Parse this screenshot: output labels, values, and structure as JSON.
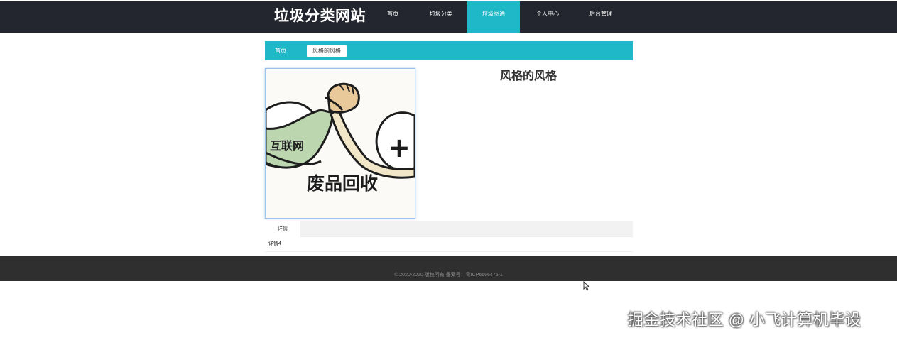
{
  "header": {
    "site_title": "垃圾分类网站",
    "nav": [
      {
        "label": "首页",
        "active": false
      },
      {
        "label": "垃圾分类",
        "active": false
      },
      {
        "label": "垃圾图通",
        "active": true
      },
      {
        "label": "个人中心",
        "active": false
      },
      {
        "label": "后台管理",
        "active": false
      }
    ]
  },
  "breadcrumb": {
    "home": "首页",
    "current": "风格的风格"
  },
  "detail": {
    "title": "风格的风格",
    "image": {
      "text_left": "互联网",
      "text_plus": "+",
      "text_bottom": "废品回收"
    }
  },
  "tabs": {
    "active_label": "详情",
    "content": "详情4"
  },
  "footer": {
    "copyright": "© 2020-2020 版权所有 备案号：粤ICP6666475-1"
  },
  "watermark": "掘金技术社区 @ 小飞计算机毕设",
  "colors": {
    "header_bg": "#23262e",
    "accent": "#1fb8c9",
    "footer_bg": "#2f2f2f"
  }
}
